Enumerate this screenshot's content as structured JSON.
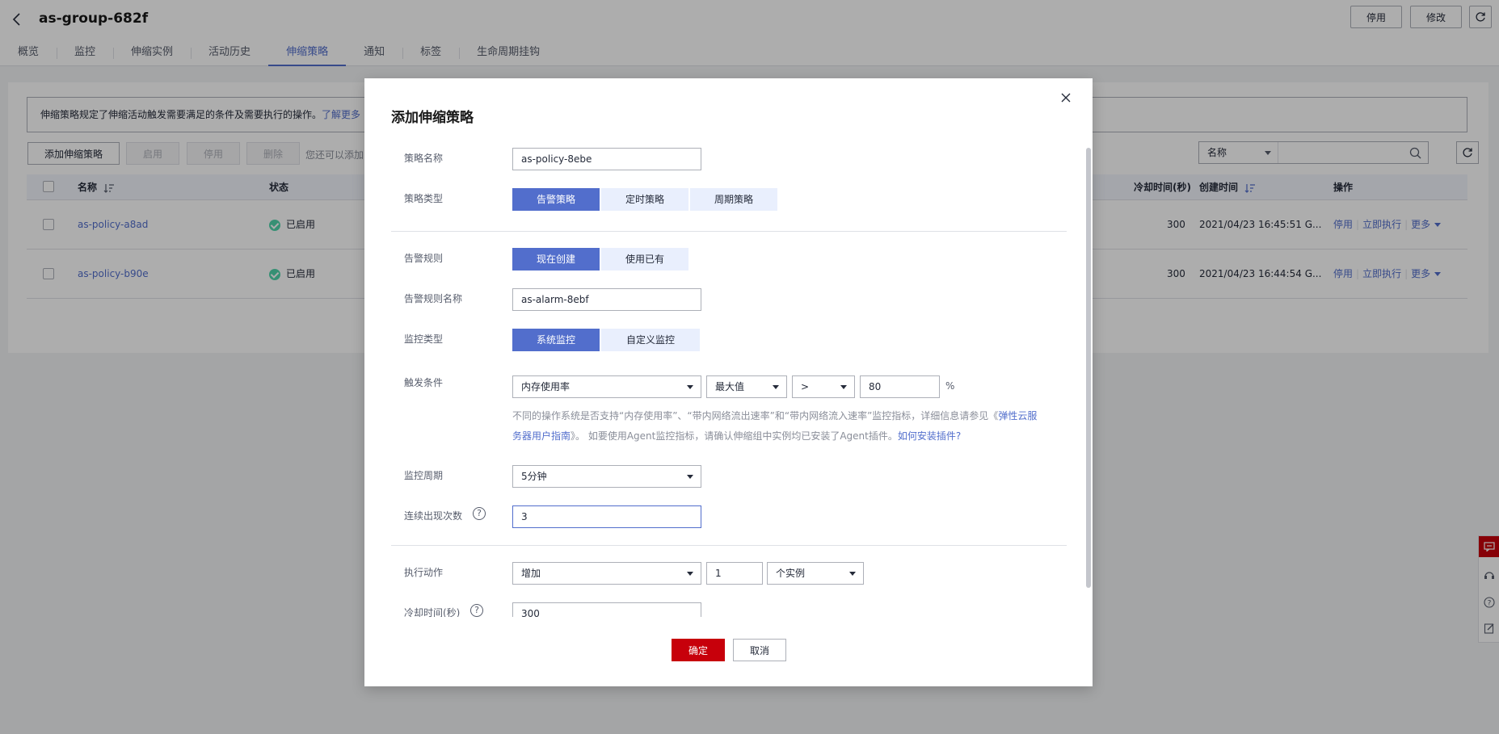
{
  "header": {
    "title": "as-group-682f",
    "stop_button": "停用",
    "edit_button": "修改",
    "tabs": [
      "概览",
      "监控",
      "伸缩实例",
      "活动历史",
      "伸缩策略",
      "通知",
      "标签",
      "生命周期挂钩"
    ],
    "active_tab": "伸缩策略"
  },
  "main": {
    "notice_text": "伸缩策略规定了伸缩活动触发需要满足的条件及需要执行的操作。",
    "notice_link": "了解更多",
    "toolbar": {
      "add": "添加伸缩策略",
      "enable": "启用",
      "disable": "停用",
      "delete": "删除",
      "hint": "您还可以添加"
    },
    "search": {
      "field": "名称"
    },
    "columns": {
      "name": "名称",
      "status": "状态",
      "cooldown": "冷却时间(秒)",
      "created": "创建时间",
      "ops": "操作"
    },
    "rows": [
      {
        "name": "as-policy-a8ad",
        "status": "已启用",
        "cooldown": "300",
        "created": "2021/04/23 16:45:51 G...",
        "op1": "停用",
        "op2": "立即执行",
        "op3": "更多"
      },
      {
        "name": "as-policy-b90e",
        "status": "已启用",
        "cooldown": "300",
        "created": "2021/04/23 16:44:54 G...",
        "op1": "停用",
        "op2": "立即执行",
        "op3": "更多"
      }
    ]
  },
  "dialog": {
    "title": "添加伸缩策略",
    "policy_name_label": "策略名称",
    "policy_name_value": "as-policy-8ebe",
    "policy_type_label": "策略类型",
    "policy_types": [
      "告警策略",
      "定时策略",
      "周期策略"
    ],
    "alarm_rule_label": "告警规则",
    "alarm_rule_options": [
      "现在创建",
      "使用已有"
    ],
    "alarm_name_label": "告警规则名称",
    "alarm_name_value": "as-alarm-8ebf",
    "monitor_type_label": "监控类型",
    "monitor_type_options": [
      "系统监控",
      "自定义监控"
    ],
    "trigger_label": "触发条件",
    "trigger_metric": "内存使用率",
    "trigger_stat": "最大值",
    "trigger_op": ">",
    "trigger_value": "80",
    "trigger_unit": "%",
    "tip_part1": "不同的操作系统是否支持“内存使用率”、“带内网络流出速率”和“带内网络流入速率”监控指标，详细信息请参见《",
    "tip_link1": "弹性云服务器用户指南",
    "tip_part2": "》。 如要使用Agent监控指标，请确认伸缩组中实例均已安装了Agent插件。",
    "tip_link2": "如何安装插件?",
    "period_label": "监控周期",
    "period_value": "5分钟",
    "count_label": "连续出现次数",
    "count_value": "3",
    "action_label": "执行动作",
    "action_value": "增加",
    "action_amount": "1",
    "action_unit": "个实例",
    "cooldown_label": "冷却时间(秒)",
    "cooldown_value": "300",
    "confirm": "确定",
    "cancel": "取消"
  },
  "colors": {
    "accent": "#526ecc",
    "primary_red": "#c7000b",
    "success": "#50d4ab"
  }
}
